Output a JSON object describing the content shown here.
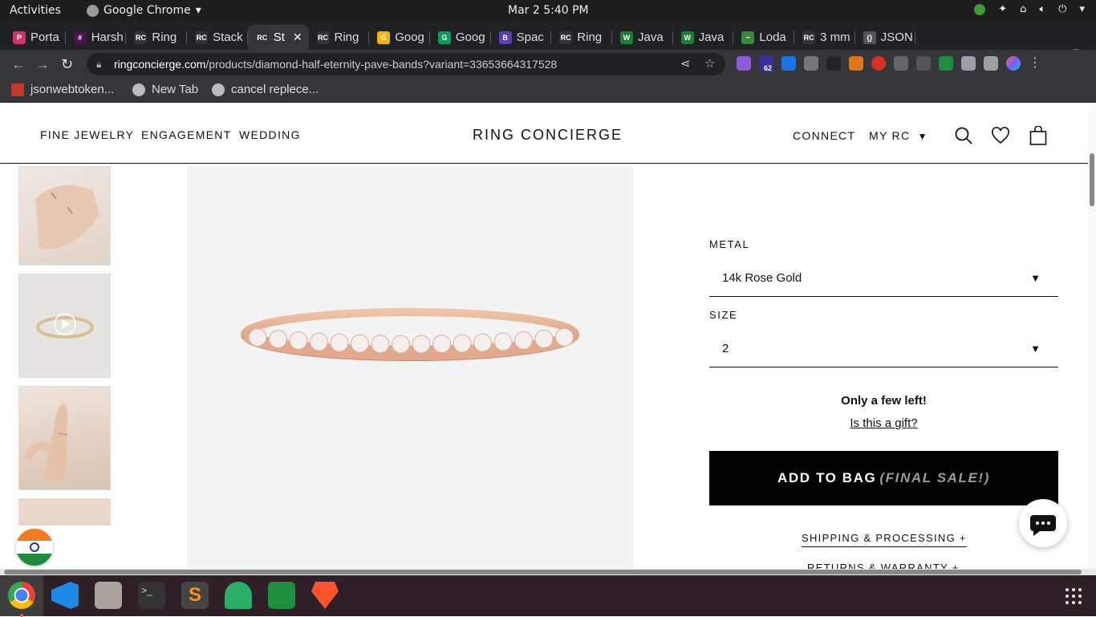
{
  "system": {
    "activities": "Activities",
    "app_name": "Google Chrome",
    "clock": "Mar 2   5:40 PM"
  },
  "tabs": [
    {
      "label": "Porta",
      "favicon": "P",
      "color": "#d6336c"
    },
    {
      "label": "Harsh",
      "favicon": "#",
      "color": "#4a154b"
    },
    {
      "label": "Ring",
      "favicon": "RC",
      "color": "#333333"
    },
    {
      "label": "Stack",
      "favicon": "RC",
      "color": "#333333"
    },
    {
      "label": "St",
      "favicon": "RC",
      "color": "#333333"
    },
    {
      "label": "Ring",
      "favicon": "RC",
      "color": "#333333"
    },
    {
      "label": "Goog",
      "favicon": "G",
      "color": "#f4b400"
    },
    {
      "label": "Goog",
      "favicon": "G",
      "color": "#0f9d58"
    },
    {
      "label": "Spac",
      "favicon": "B",
      "color": "#5b3fb8"
    },
    {
      "label": "Ring",
      "favicon": "RC",
      "color": "#333333"
    },
    {
      "label": "Java",
      "favicon": "W",
      "color": "#1a7f37"
    },
    {
      "label": "Java",
      "favicon": "W",
      "color": "#1a7f37"
    },
    {
      "label": "Loda",
      "favicon": "~",
      "color": "#3b873e"
    },
    {
      "label": "3 mm",
      "favicon": "RC",
      "color": "#333333"
    },
    {
      "label": "JSON",
      "favicon": "{}",
      "color": "#555555"
    }
  ],
  "active_tab_index": 4,
  "address": {
    "host": "ringconcierge.com",
    "path": "/products/diamond-half-eternity-pave-bands?variant=33653664317528"
  },
  "extension_badge": "62",
  "bookmarks": [
    {
      "label": "jsonwebtoken...",
      "color": "#c0392b"
    },
    {
      "label": "New Tab",
      "color": "#bbbbbb"
    },
    {
      "label": "cancel replece...",
      "color": "#bbbbbb"
    }
  ],
  "site": {
    "nav": {
      "fine_jewelry": "FINE JEWELRY",
      "engagement": "ENGAGEMENT",
      "wedding": "WEDDING"
    },
    "logo": "RING CONCIERGE",
    "connect": "CONNECT",
    "my_rc": "MY RC",
    "my_rc_caret": "▼"
  },
  "product": {
    "metal_label": "METAL",
    "metal_value": "14k Rose Gold",
    "size_label": "SIZE",
    "size_value": "2",
    "dropdown_caret": "▼",
    "stock_note": "Only a few left!",
    "gift_link": "Is this a gift?",
    "add_to_bag": "ADD TO BAG",
    "final_sale": "(FINAL SALE!)",
    "shipping": "SHIPPING & PROCESSING +",
    "returns": "RETURNS & WARRANTY +",
    "ring_color": "#e3a98c"
  }
}
